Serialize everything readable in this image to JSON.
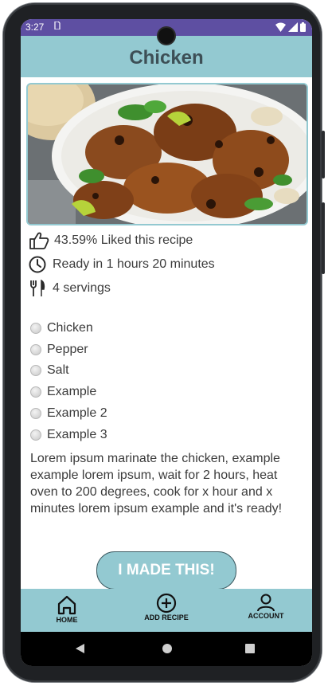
{
  "status_bar": {
    "time": "3:27",
    "sim_icon": "sim-card-icon",
    "icons": [
      "wifi-icon",
      "cell-signal-icon",
      "battery-icon"
    ]
  },
  "header": {
    "title": "Chicken"
  },
  "recipe": {
    "image_alt": "grilled-chicken-drumsticks-photo",
    "likes": "43.59% Liked this recipe",
    "ready_time": "Ready in 1 hours 20 minutes",
    "servings": "4 servings",
    "ingredients": [
      "Chicken",
      "Pepper",
      "Salt",
      "Example",
      "Example 2",
      "Example 3"
    ],
    "description": "Lorem ipsum marinate the chicken, example example lorem ipsum, wait for 2 hours, heat oven to 200 degrees, cook for x hour and x minutes lorem ipsum example and it's ready!",
    "made_button": "I MADE THIS!"
  },
  "bottom_nav": {
    "items": [
      {
        "label": "HOME",
        "icon": "home-icon"
      },
      {
        "label": "ADD RECIPE",
        "icon": "add-circle-icon"
      },
      {
        "label": "ACCOUNT",
        "icon": "account-icon"
      }
    ]
  },
  "colors": {
    "accent": "#93c9d1",
    "status_bar": "#5e4fa2",
    "text": "#3b3b3b",
    "title": "#3d4f56"
  }
}
